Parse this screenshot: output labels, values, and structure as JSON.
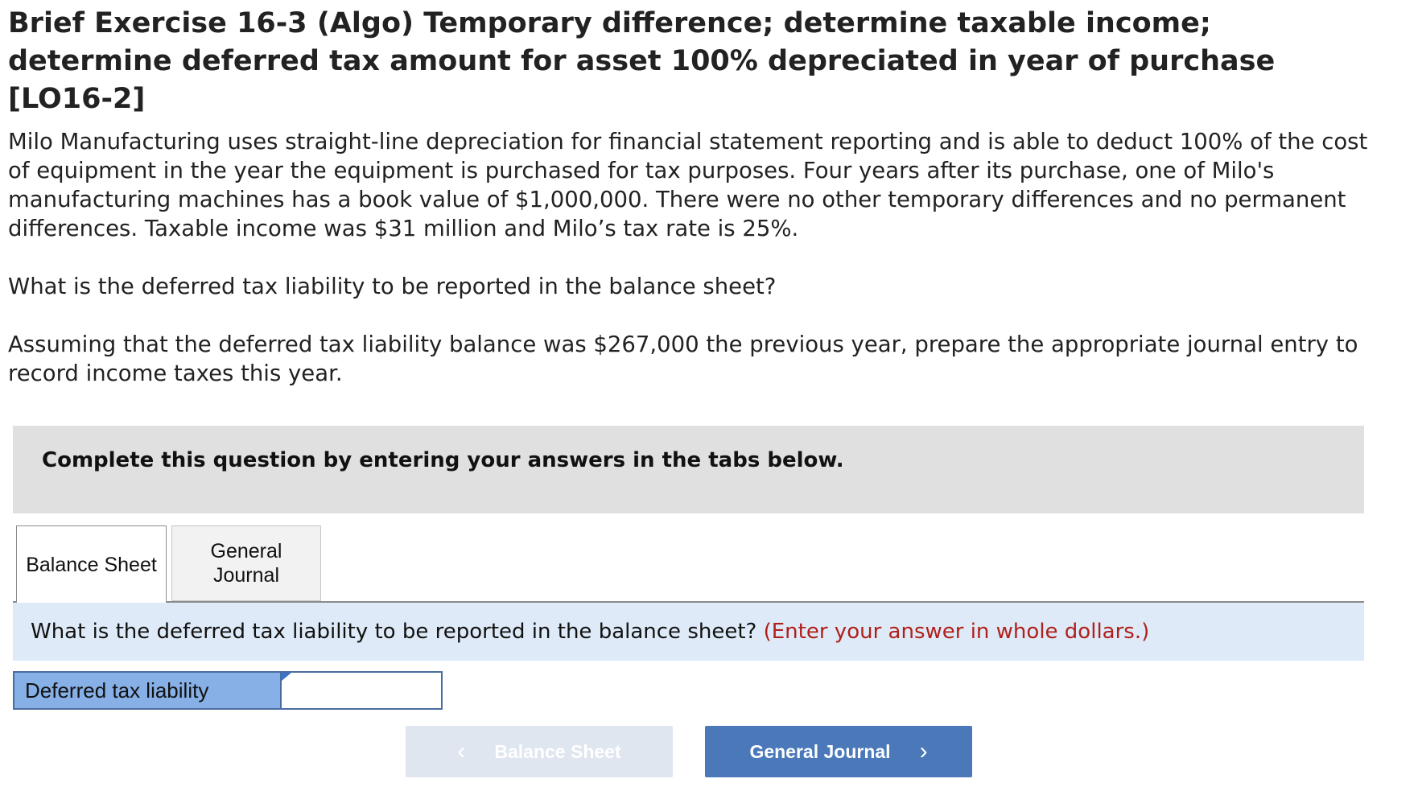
{
  "exercise": {
    "title": "Brief Exercise 16-3 (Algo) Temporary difference; determine taxable income; determine deferred tax amount for asset 100% depreciated in year of purchase [LO16-2]",
    "paragraphs": [
      "Milo Manufacturing uses straight-line depreciation for financial statement reporting and is able to deduct 100% of the cost of equipment in the year the equipment is purchased for tax purposes. Four years after its purchase, one of Milo's manufacturing machines has a book value of $1,000,000. There were no other temporary differences and no permanent differences. Taxable income was $31 million and Milo’s tax rate is 25%.",
      "What is the deferred tax liability to be reported in the balance sheet?",
      "Assuming that the deferred tax liability balance was $267,000 the previous year, prepare the appropriate journal entry to record income taxes this year."
    ]
  },
  "instructions": "Complete this question by entering your answers in the tabs below.",
  "tabs": [
    {
      "label": "Balance Sheet",
      "active": true
    },
    {
      "label": "General Journal",
      "active": false
    }
  ],
  "question": {
    "text": "What is the deferred tax liability to be reported in the balance sheet?",
    "hint": "(Enter your answer in whole dollars.)"
  },
  "answer_row": {
    "label": "Deferred tax liability",
    "value": "",
    "placeholder": ""
  },
  "navigation": {
    "prev_label": "Balance Sheet",
    "prev_enabled": false,
    "next_label": "General Journal",
    "next_enabled": true,
    "prev_icon": "chevron-left-icon",
    "next_icon": "chevron-right-icon"
  },
  "colors": {
    "instructions_bg": "#e0e0e0",
    "question_bg": "#deeaf7",
    "hint_red": "#b0201b",
    "label_cell_bg": "#86b0e6",
    "primary_button": "#4a78b9",
    "disabled_button": "#dfe6f0"
  }
}
